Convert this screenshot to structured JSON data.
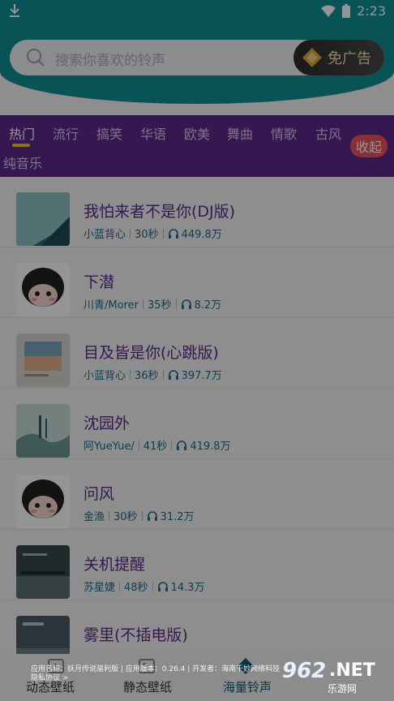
{
  "status": {
    "time": "2:23",
    "wifi_icon": "wifi-icon",
    "battery_icon": "battery-icon",
    "download_icon": "download-icon"
  },
  "search": {
    "placeholder": "搜索你喜欢的铃声"
  },
  "ad_button": {
    "label": "免广告"
  },
  "tabs": [
    {
      "label": "热门"
    },
    {
      "label": "流行"
    },
    {
      "label": "搞笑"
    },
    {
      "label": "华语"
    },
    {
      "label": "欧美"
    },
    {
      "label": "舞曲"
    },
    {
      "label": "情歌"
    },
    {
      "label": "古风"
    },
    {
      "label": "纯音乐"
    }
  ],
  "collapse_label": "收起",
  "songs": [
    {
      "title": "我怕来者不是你(DJ版)",
      "artist": "小蓝背心",
      "duration": "30秒",
      "plays": "449.8万"
    },
    {
      "title": "下潜",
      "artist": "川青/Morer",
      "duration": "35秒",
      "plays": "8.2万"
    },
    {
      "title": "目及皆是你(心跳版)",
      "artist": "小蓝背心",
      "duration": "36秒",
      "plays": "397.7万"
    },
    {
      "title": "沈园外",
      "artist": "阿YueYue/",
      "duration": "41秒",
      "plays": "419.8万"
    },
    {
      "title": "问风",
      "artist": "金渔",
      "duration": "30秒",
      "plays": "31.2万"
    },
    {
      "title": "关机提醒",
      "artist": "苏星婕",
      "duration": "48秒",
      "plays": "14.3万"
    },
    {
      "title": "雾里(不插电版)",
      "artist": "",
      "duration": "",
      "plays": ""
    }
  ],
  "bottom_nav": [
    {
      "label": "动态壁纸"
    },
    {
      "label": "静态壁纸"
    },
    {
      "label": "海量铃声"
    }
  ],
  "footer": {
    "line1": "应用名称：妖月传说驱利版 | 应用版本：0.26.4 | 开发者：海南千妙网络科技",
    "line2": "隐私协议 >"
  },
  "watermark": {
    "num": "962",
    "net": ".NET",
    "cn": "乐游网"
  },
  "colors": {
    "teal": "#0f8f93",
    "purple": "#5e2a8c",
    "accent": "#f5c518",
    "collapse": "#e9555e"
  }
}
